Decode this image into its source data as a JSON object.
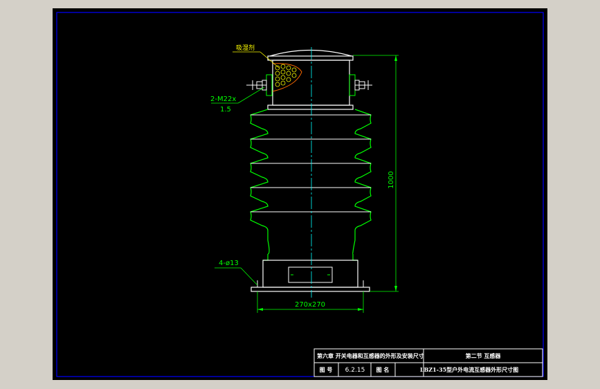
{
  "annotations": {
    "desiccant_label": "吸湿剂",
    "bolt_label_line1": "2-M22x",
    "bolt_label_line2": "1.5",
    "height_dim": "1000",
    "base_hole_label": "4-ø13",
    "base_width_dim": "270x270"
  },
  "title_block": {
    "chapter": "第六章  开关电器和互感器的外形及安装尺寸",
    "section": "第二节  互感器",
    "figure_no_label": "图  号",
    "figure_no_value": "6.2.15",
    "figure_name_label": "图  名",
    "figure_name_value": "LBZ1-35型户外电流互感器外形尺寸图"
  },
  "colors": {
    "background": "#000000",
    "frame": "#0000ff",
    "outline": "#ffffff",
    "insulator": "#00ff00",
    "dimension": "#00ff00",
    "centerline": "#00ffff",
    "leader": "#ffff00",
    "app_chrome": "#d4d0c8"
  }
}
